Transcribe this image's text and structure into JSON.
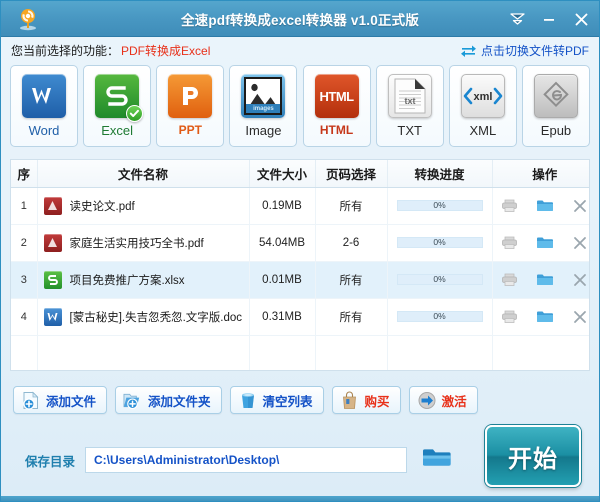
{
  "window": {
    "title": "全速pdf转换成excel转换器 v1.0正式版",
    "logo_icon": "app-logo-icon",
    "controls": [
      {
        "name": "menu-button",
        "icon": "chevron-down-icon",
        "label": "▼"
      },
      {
        "name": "minimize-button",
        "icon": "minimize-icon",
        "label": "—"
      },
      {
        "name": "close-button",
        "icon": "close-icon",
        "label": "✕"
      }
    ]
  },
  "function_row": {
    "label": "您当前选择的功能：",
    "value": "PDF转换成Excel",
    "value_color": "#e8311a",
    "switch_link": "点击切换文件转PDF",
    "switch_icon": "swap-arrows-icon",
    "link_color": "#1452c7"
  },
  "formats": [
    {
      "key": "word",
      "label": "Word",
      "glyph": "W",
      "selected": false
    },
    {
      "key": "excel",
      "label": "Excel",
      "glyph": "S",
      "selected": true
    },
    {
      "key": "ppt",
      "label": "PPT",
      "glyph": "P",
      "selected": false
    },
    {
      "key": "image",
      "label": "Image",
      "glyph": "images",
      "selected": false
    },
    {
      "key": "html",
      "label": "HTML",
      "glyph": "HTML",
      "selected": false
    },
    {
      "key": "txt",
      "label": "TXT",
      "glyph": "txt",
      "selected": false
    },
    {
      "key": "xml",
      "label": "XML",
      "glyph": "xml",
      "selected": false
    },
    {
      "key": "epub",
      "label": "Epub",
      "glyph": "e",
      "selected": false
    }
  ],
  "table": {
    "headers": [
      "序",
      "文件名称",
      "文件大小",
      "页码选择",
      "转换进度",
      "操作"
    ],
    "rows": [
      {
        "index": "1",
        "filename": "读史论文.pdf",
        "filetype": "pdf",
        "size": "0.19MB",
        "pages": "所有",
        "progress": "0%",
        "progress_value": 0,
        "selected": false
      },
      {
        "index": "2",
        "filename": "家庭生活实用技巧全书.pdf",
        "filetype": "pdf",
        "size": "54.04MB",
        "pages": "2-6",
        "progress": "0%",
        "progress_value": 0,
        "selected": false
      },
      {
        "index": "3",
        "filename": "项目免费推广方案.xlsx",
        "filetype": "excel",
        "size": "0.01MB",
        "pages": "所有",
        "progress": "0%",
        "progress_value": 0,
        "selected": true
      },
      {
        "index": "4",
        "filename": "[蒙古秘史].失吉忽秃忽.文字版.doc",
        "filetype": "word",
        "size": "0.31MB",
        "pages": "所有",
        "progress": "0%",
        "progress_value": 0,
        "selected": false
      }
    ],
    "row_ops": [
      "preview-icon",
      "open-folder-icon",
      "remove-icon"
    ]
  },
  "actions": [
    {
      "key": "add-file",
      "label": "添加文件",
      "icon": "add-file-icon",
      "color": "#1452c7"
    },
    {
      "key": "add-folder",
      "label": "添加文件夹",
      "icon": "add-folder-icon",
      "color": "#1452c7"
    },
    {
      "key": "clear-list",
      "label": "清空列表",
      "icon": "trash-icon",
      "color": "#1452c7"
    },
    {
      "key": "purchase",
      "label": "购买",
      "icon": "shopping-bag-icon",
      "color": "#e8311a"
    },
    {
      "key": "activate",
      "label": "激活",
      "icon": "arrow-right-icon",
      "color": "#e8311a"
    }
  ],
  "bottom": {
    "save_label": "保存目录",
    "save_path": "C:\\Users\\Administrator\\Desktop\\",
    "browse_icon": "folder-icon",
    "start_label": "开始",
    "start_color": "#1b8fa3"
  }
}
